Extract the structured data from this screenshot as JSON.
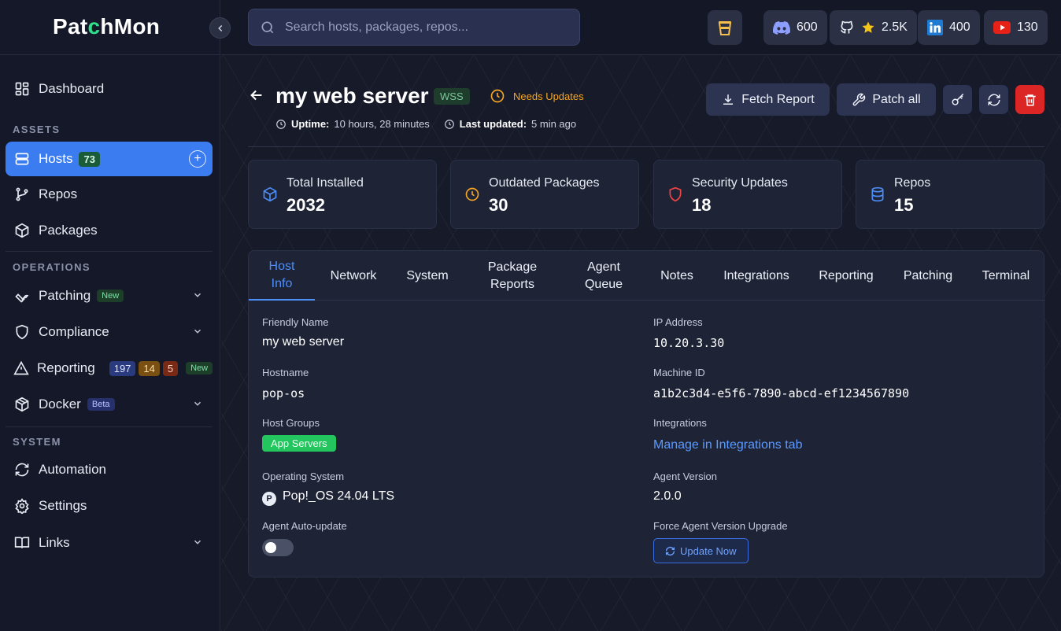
{
  "app": {
    "logo_prefix": "Pat",
    "logo_pac": "c",
    "logo_suffix": "hMon"
  },
  "sidebar": {
    "sections": {
      "assets": "ASSETS",
      "operations": "OPERATIONS",
      "system": "SYSTEM"
    },
    "items": {
      "dashboard": "Dashboard",
      "hosts": "Hosts",
      "hosts_count": "73",
      "repos": "Repos",
      "packages": "Packages",
      "patching": "Patching",
      "patching_badge": "New",
      "compliance": "Compliance",
      "reporting": "Reporting",
      "reporting_counts": [
        "197",
        "14",
        "5"
      ],
      "reporting_badge": "New",
      "docker": "Docker",
      "docker_badge": "Beta",
      "automation": "Automation",
      "settings": "Settings",
      "links": "Links"
    }
  },
  "topbar": {
    "search_placeholder": "Search hosts, packages, repos...",
    "social": {
      "discord": "600",
      "github": "2.5K",
      "linkedin": "400",
      "youtube": "130"
    }
  },
  "host": {
    "title": "my web server",
    "connection_badge": "WSS",
    "status": "Needs Updates",
    "uptime_label": "Uptime:",
    "uptime_value": "10 hours, 28 minutes",
    "last_updated_label": "Last updated:",
    "last_updated_value": "5 min ago"
  },
  "actions": {
    "fetch_report": "Fetch Report",
    "patch_all": "Patch all"
  },
  "stats": [
    {
      "label": "Total Installed",
      "value": "2032"
    },
    {
      "label": "Outdated Packages",
      "value": "30"
    },
    {
      "label": "Security Updates",
      "value": "18"
    },
    {
      "label": "Repos",
      "value": "15"
    }
  ],
  "tabs": [
    {
      "l1": "Host",
      "l2": "Info"
    },
    {
      "l1": "Network",
      "l2": ""
    },
    {
      "l1": "System",
      "l2": ""
    },
    {
      "l1": "Package",
      "l2": "Reports"
    },
    {
      "l1": "Agent",
      "l2": "Queue"
    },
    {
      "l1": "Notes",
      "l2": ""
    },
    {
      "l1": "Integrations",
      "l2": ""
    },
    {
      "l1": "Reporting",
      "l2": ""
    },
    {
      "l1": "Patching",
      "l2": ""
    },
    {
      "l1": "Terminal",
      "l2": ""
    }
  ],
  "host_info": {
    "friendly_name_label": "Friendly Name",
    "friendly_name": "my web server",
    "hostname_label": "Hostname",
    "hostname": "pop-os",
    "host_groups_label": "Host Groups",
    "host_group": "App Servers",
    "os_label": "Operating System",
    "os": "Pop!_OS 24.04 LTS",
    "auto_update_label": "Agent Auto-update",
    "auto_update_enabled": false,
    "ip_label": "IP Address",
    "ip": "10.20.3.30",
    "machine_id_label": "Machine ID",
    "machine_id": "a1b2c3d4-e5f6-7890-abcd-ef1234567890",
    "integrations_label": "Integrations",
    "integrations_link": "Manage in Integrations tab",
    "agent_version_label": "Agent Version",
    "agent_version": "2.0.0",
    "force_upgrade_label": "Force Agent Version Upgrade",
    "update_now": "Update Now"
  },
  "colors": {
    "accent": "#3b7cf0",
    "warning": "#f5a524",
    "danger": "#dc2626",
    "success": "#22c55e"
  }
}
